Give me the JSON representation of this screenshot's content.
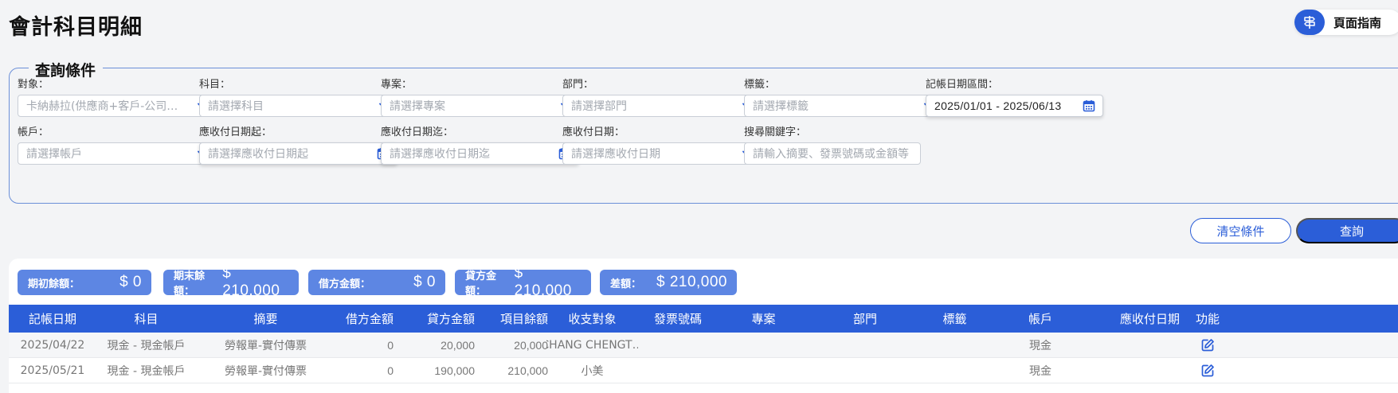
{
  "page": {
    "title": "會計科目明細",
    "guide_label": "頁面指南"
  },
  "query": {
    "legend": "查詢條件",
    "fields": {
      "target": {
        "label": "對象：",
        "value": "卡納赫拉(供應商+客戶-公司…",
        "type": "select"
      },
      "subject": {
        "label": "科目：",
        "placeholder": "請選擇科目",
        "type": "select"
      },
      "project": {
        "label": "專案：",
        "placeholder": "請選擇專案",
        "type": "select"
      },
      "dept": {
        "label": "部門：",
        "placeholder": "請選擇部門",
        "type": "select"
      },
      "tag": {
        "label": "標籤：",
        "placeholder": "請選擇標籤",
        "type": "select"
      },
      "date_range": {
        "label": "記帳日期區間：",
        "value": "2025/01/01 - 2025/06/13",
        "type": "date"
      },
      "account": {
        "label": "帳戶：",
        "placeholder": "請選擇帳戶",
        "type": "select"
      },
      "due_start": {
        "label": "應收付日期起：",
        "placeholder": "請選擇應收付日期起",
        "type": "date"
      },
      "due_end": {
        "label": "應收付日期迄：",
        "placeholder": "請選擇應收付日期迄",
        "type": "date"
      },
      "due_date": {
        "label": "應收付日期：",
        "placeholder": "請選擇應收付日期",
        "type": "select"
      },
      "keyword": {
        "label": "搜尋關鍵字：",
        "placeholder": "請輸入摘要、發票號碼或金額等",
        "type": "text"
      }
    },
    "clear_label": "清空條件",
    "search_label": "查詢"
  },
  "summary": [
    {
      "label": "期初餘額：",
      "value": "$ 0"
    },
    {
      "label": "期末餘額：",
      "value": "$ 210,000"
    },
    {
      "label": "借方金額：",
      "value": "$ 0"
    },
    {
      "label": "貸方金額：",
      "value": "$ 210,000"
    },
    {
      "label": "差額：",
      "value": "$ 210,000"
    }
  ],
  "table": {
    "headers": [
      "記帳日期",
      "科目",
      "摘要",
      "借方金額",
      "貸方金額",
      "項目餘額",
      "收支對象",
      "發票號碼",
      "專案",
      "部門",
      "標籤",
      "帳戶",
      "應收付日期",
      "功能"
    ],
    "rows": [
      [
        "2025/04/22",
        "現金 - 現金帳戶",
        "勞報單-實付傳票",
        "0",
        "20,000",
        "20,000",
        "CHANG CHENGT…",
        "",
        "",
        "",
        "",
        "現金",
        "",
        ""
      ],
      [
        "2025/05/21",
        "現金 - 現金帳戶",
        "勞報單-實付傳票",
        "0",
        "190,000",
        "210,000",
        "小美",
        "",
        "",
        "",
        "",
        "現金",
        "",
        ""
      ]
    ]
  },
  "colors": {
    "primary": "#2b5ed8",
    "summary_bg": "#5d86e3"
  },
  "icons": {
    "guide": "signpost-icon",
    "select": "chevron-down-icon",
    "date": "calendar-icon",
    "edit": "edit-icon"
  }
}
